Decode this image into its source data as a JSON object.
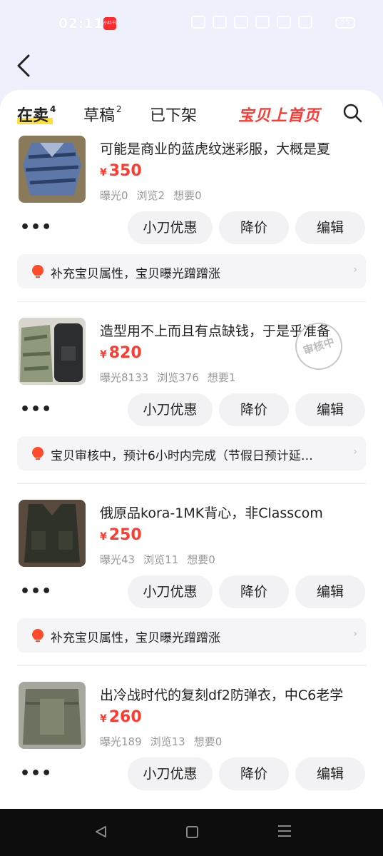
{
  "status_bar": {
    "time": "02:11",
    "app_badge": "小红书",
    "battery": "55"
  },
  "tabs": [
    {
      "label": "在卖",
      "count": "4"
    },
    {
      "label": "草稿",
      "count": "2"
    },
    {
      "label": "已下架",
      "count": ""
    }
  ],
  "promo_label": "宝贝上首页",
  "actions": {
    "more": "•••",
    "coupon": "小刀优惠",
    "reduce_price": "降价",
    "edit": "编辑"
  },
  "review_stamp": "审核中",
  "items": [
    {
      "title": "可能是商业的蓝虎纹迷彩服，大概是夏",
      "currency": "¥",
      "price": "350",
      "exposure": "曝光0",
      "views": "浏览2",
      "wants": "想要0",
      "tip": "补充宝贝属性，宝贝曝光蹭蹭涨"
    },
    {
      "title": "造型用不上而且有点缺钱，于是乎准备",
      "currency": "¥",
      "price": "820",
      "exposure": "曝光8133",
      "views": "浏览376",
      "wants": "想要1",
      "tip": "宝贝审核中，预计6小时内完成（节假日预计延…"
    },
    {
      "title": "俄原品kora-1MK背心，非Classcom",
      "currency": "¥",
      "price": "250",
      "exposure": "曝光43",
      "views": "浏览11",
      "wants": "想要0",
      "tip": "补充宝贝属性，宝贝曝光蹭蹭涨"
    },
    {
      "title": "出冷战时代的复刻df2防弹衣，中C6老学",
      "currency": "¥",
      "price": "260",
      "exposure": "曝光189",
      "views": "浏览13",
      "wants": "想要0",
      "tip": ""
    }
  ],
  "colors": {
    "accent": "#ff3b30",
    "tab_highlight": "#ffe033",
    "background": "#eef0fb"
  }
}
